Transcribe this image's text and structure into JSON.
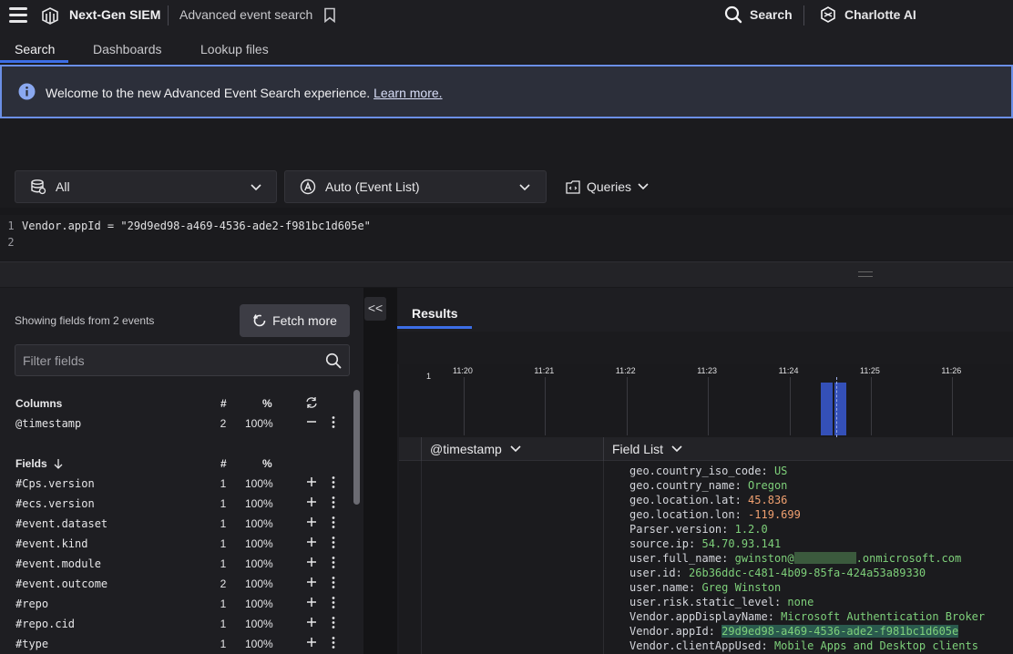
{
  "topbar": {
    "product_title": "Next-Gen SIEM",
    "page_name": "Advanced event search",
    "search_label": "Search",
    "assistant_label": "Charlotte AI"
  },
  "tabs": [
    {
      "label": "Search",
      "active": true
    },
    {
      "label": "Dashboards",
      "active": false
    },
    {
      "label": "Lookup files",
      "active": false
    }
  ],
  "banner": {
    "text": "Welcome to the new Advanced Event Search experience.",
    "link": "Learn more."
  },
  "selectors": {
    "repository": "All",
    "mode": "Auto (Event List)",
    "queries_label": "Queries"
  },
  "editor": {
    "lines": [
      {
        "num": "1",
        "text": "Vendor.appId = \"29d9ed98-a469-4536-ade2-f981bc1d605e\""
      },
      {
        "num": "2",
        "text": ""
      }
    ]
  },
  "fields_panel": {
    "showing_text": "Showing fields from 2 events",
    "fetch_more_label": "Fetch more",
    "filter_placeholder": "Filter fields",
    "columns_header": "Columns",
    "fields_header": "Fields",
    "count_header": "#",
    "pct_header": "%",
    "collapse_glyph": "<<",
    "columns": [
      {
        "name": "@timestamp",
        "count": "2",
        "pct": "100%"
      }
    ],
    "fields": [
      {
        "name": "#Cps.version",
        "count": "1",
        "pct": "100%"
      },
      {
        "name": "#ecs.version",
        "count": "1",
        "pct": "100%"
      },
      {
        "name": "#event.dataset",
        "count": "1",
        "pct": "100%"
      },
      {
        "name": "#event.kind",
        "count": "1",
        "pct": "100%"
      },
      {
        "name": "#event.module",
        "count": "1",
        "pct": "100%"
      },
      {
        "name": "#event.outcome",
        "count": "2",
        "pct": "100%"
      },
      {
        "name": "#repo",
        "count": "1",
        "pct": "100%"
      },
      {
        "name": "#repo.cid",
        "count": "1",
        "pct": "100%"
      },
      {
        "name": "#type",
        "count": "1",
        "pct": "100%"
      }
    ]
  },
  "results": {
    "tab_label": "Results",
    "timeline": {
      "y_max_label": "1",
      "ticks": [
        "11:20",
        "11:21",
        "11:22",
        "11:23",
        "11:24",
        "11:25",
        "11:26"
      ],
      "bars": [
        {
          "time": "11:24:28",
          "count": 1
        },
        {
          "time": "11:24:38",
          "count": 1
        }
      ]
    },
    "columns": [
      "@timestamp",
      "Field List"
    ],
    "field_list": [
      {
        "key": "geo.country_iso_code",
        "value": "US",
        "type": "str"
      },
      {
        "key": "geo.country_name",
        "value": "Oregon",
        "type": "str"
      },
      {
        "key": "geo.location.lat",
        "value": "45.836",
        "type": "num"
      },
      {
        "key": "geo.location.lon",
        "value": "-119.699",
        "type": "num"
      },
      {
        "key": "Parser.version",
        "value": "1.2.0",
        "type": "str"
      },
      {
        "key": "source.ip",
        "value": "54.70.93.141",
        "type": "str"
      },
      {
        "key": "user.full_name",
        "value_prefix": "gwinston@",
        "value_suffix": ".onmicrosoft.com",
        "type": "redacted"
      },
      {
        "key": "user.id",
        "value": "26b36ddc-c481-4b09-85fa-424a53a89330",
        "type": "str"
      },
      {
        "key": "user.name",
        "value": "Greg Winston",
        "type": "str"
      },
      {
        "key": "user.risk.static_level",
        "value": "none",
        "type": "str"
      },
      {
        "key": "Vendor.appDisplayName",
        "value": "Microsoft Authentication Broker",
        "type": "str"
      },
      {
        "key": "Vendor.appId",
        "value": "29d9ed98-a469-4536-ade2-f981bc1d605e",
        "type": "highlight"
      },
      {
        "key": "Vendor.clientAppUsed",
        "value": "Mobile Apps and Desktop clients",
        "type": "str"
      }
    ]
  },
  "colors": {
    "accent": "#3c6ee6",
    "string_value": "#7ed07a",
    "number_value": "#f0a070",
    "timeline_bar": "#3450b8"
  }
}
